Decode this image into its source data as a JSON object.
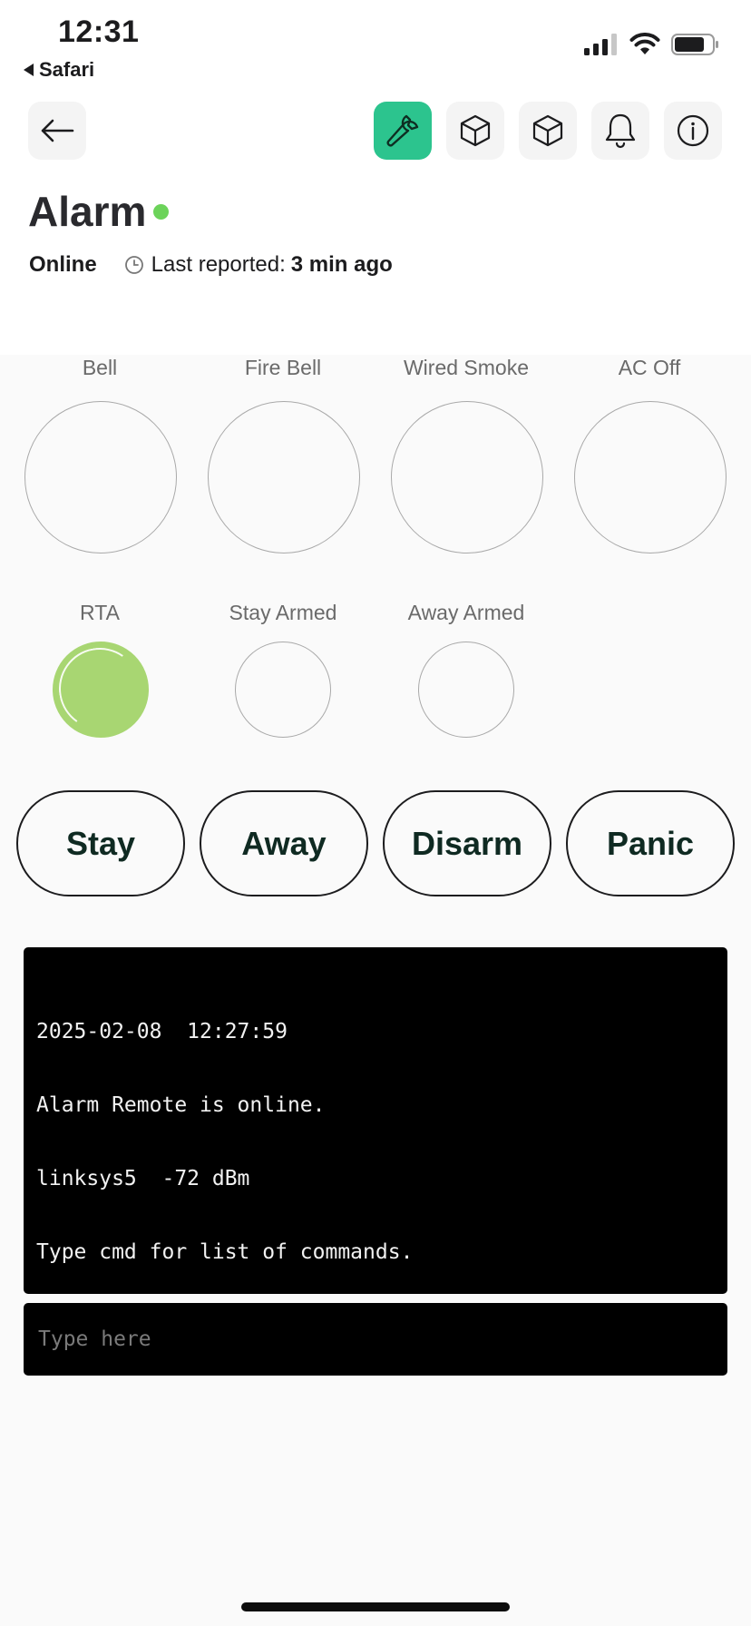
{
  "status_bar": {
    "time": "12:31",
    "back_app": "Safari"
  },
  "header": {
    "icons": [
      {
        "name": "wrench-icon",
        "active": true
      },
      {
        "name": "cube-icon",
        "active": false
      },
      {
        "name": "cube-icon",
        "active": false
      },
      {
        "name": "bell-icon",
        "active": false
      },
      {
        "name": "info-icon",
        "active": false
      }
    ],
    "active_color": "#2cc48e"
  },
  "device": {
    "title": "Alarm",
    "status": "Online",
    "status_color": "#6cd35a",
    "last_reported_label": "Last reported:",
    "last_reported_value": "3 min ago"
  },
  "indicators": {
    "row1": [
      {
        "label": "Bell",
        "lit": false
      },
      {
        "label": "Fire Bell",
        "lit": false
      },
      {
        "label": "Wired Smoke",
        "lit": false
      },
      {
        "label": "AC Off",
        "lit": false
      }
    ],
    "row2": [
      {
        "label": "RTA",
        "lit": true
      },
      {
        "label": "Stay Armed",
        "lit": false
      },
      {
        "label": "Away Armed",
        "lit": false
      }
    ],
    "lit_color": "#a8d672"
  },
  "actions": [
    "Stay",
    "Away",
    "Disarm",
    "Panic"
  ],
  "terminal": {
    "lines": [
      "2025-02-08  12:27:59",
      "Alarm Remote is online.",
      "linksys5  -72 dBm",
      "Type cmd for list of commands."
    ],
    "input_placeholder": "Type here",
    "input_value": ""
  }
}
